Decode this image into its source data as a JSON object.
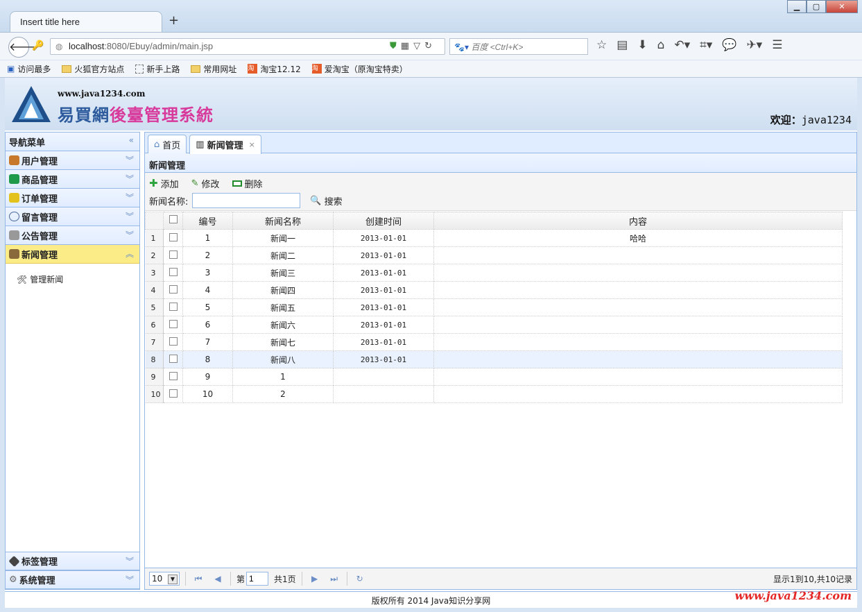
{
  "browser": {
    "tab_title": "Insert title here",
    "new_tab": "+",
    "url_host": "localhost",
    "url_rest": ":8080/Ebuy/admin/main.jsp",
    "search_placeholder": "百度 <Ctrl+K>",
    "bookmarks": [
      "访问最多",
      "火狐官方站点",
      "新手上路",
      "常用网址",
      "淘宝12.12",
      "爱淘宝（原淘宝特卖）"
    ]
  },
  "header": {
    "site": "www.java1234.com",
    "sys_part1": "易買網",
    "sys_part2": "後臺管理系統",
    "welcome_label": "欢迎：",
    "welcome_user": "java1234"
  },
  "sidebar": {
    "title": "导航菜单",
    "items": [
      {
        "label": "用户管理",
        "color": "#c8782a"
      },
      {
        "label": "商品管理",
        "color": "#1e9a4a"
      },
      {
        "label": "订单管理",
        "color": "#e3c21c"
      },
      {
        "label": "留言管理",
        "color": "#4a6b9a"
      },
      {
        "label": "公告管理",
        "color": "#666666"
      },
      {
        "label": "新闻管理",
        "color": "#8a6a3a"
      }
    ],
    "sub_item": "管理新闻",
    "bottom_items": [
      "标签管理",
      "系统管理"
    ]
  },
  "main": {
    "tabs": [
      "首页",
      "新闻管理"
    ],
    "panel_title": "新闻管理",
    "toolbar": {
      "add": "添加",
      "edit": "修改",
      "delete": "删除",
      "search_label": "新闻名称:",
      "search_btn": "搜索"
    },
    "columns": [
      "编号",
      "新闻名称",
      "创建时间",
      "内容"
    ],
    "rows": [
      {
        "id": "1",
        "name": "新闻一",
        "date": "2013-01-01",
        "content": "哈哈"
      },
      {
        "id": "2",
        "name": "新闻二",
        "date": "2013-01-01",
        "content": ""
      },
      {
        "id": "3",
        "name": "新闻三",
        "date": "2013-01-01",
        "content": ""
      },
      {
        "id": "4",
        "name": "新闻四",
        "date": "2013-01-01",
        "content": ""
      },
      {
        "id": "5",
        "name": "新闻五",
        "date": "2013-01-01",
        "content": ""
      },
      {
        "id": "6",
        "name": "新闻六",
        "date": "2013-01-01",
        "content": ""
      },
      {
        "id": "7",
        "name": "新闻七",
        "date": "2013-01-01",
        "content": ""
      },
      {
        "id": "8",
        "name": "新闻八",
        "date": "2013-01-01",
        "content": ""
      },
      {
        "id": "9",
        "name": "1",
        "date": "",
        "content": ""
      },
      {
        "id": "10",
        "name": "2",
        "date": "",
        "content": ""
      }
    ],
    "pager": {
      "page_size": "10",
      "page_prefix": "第",
      "page_value": "1",
      "page_suffix": "共1页",
      "info": "显示1到10,共10记录"
    }
  },
  "footer": {
    "text": "版权所有 2014 Java知识分享网",
    "watermark": "www.java1234.com"
  }
}
